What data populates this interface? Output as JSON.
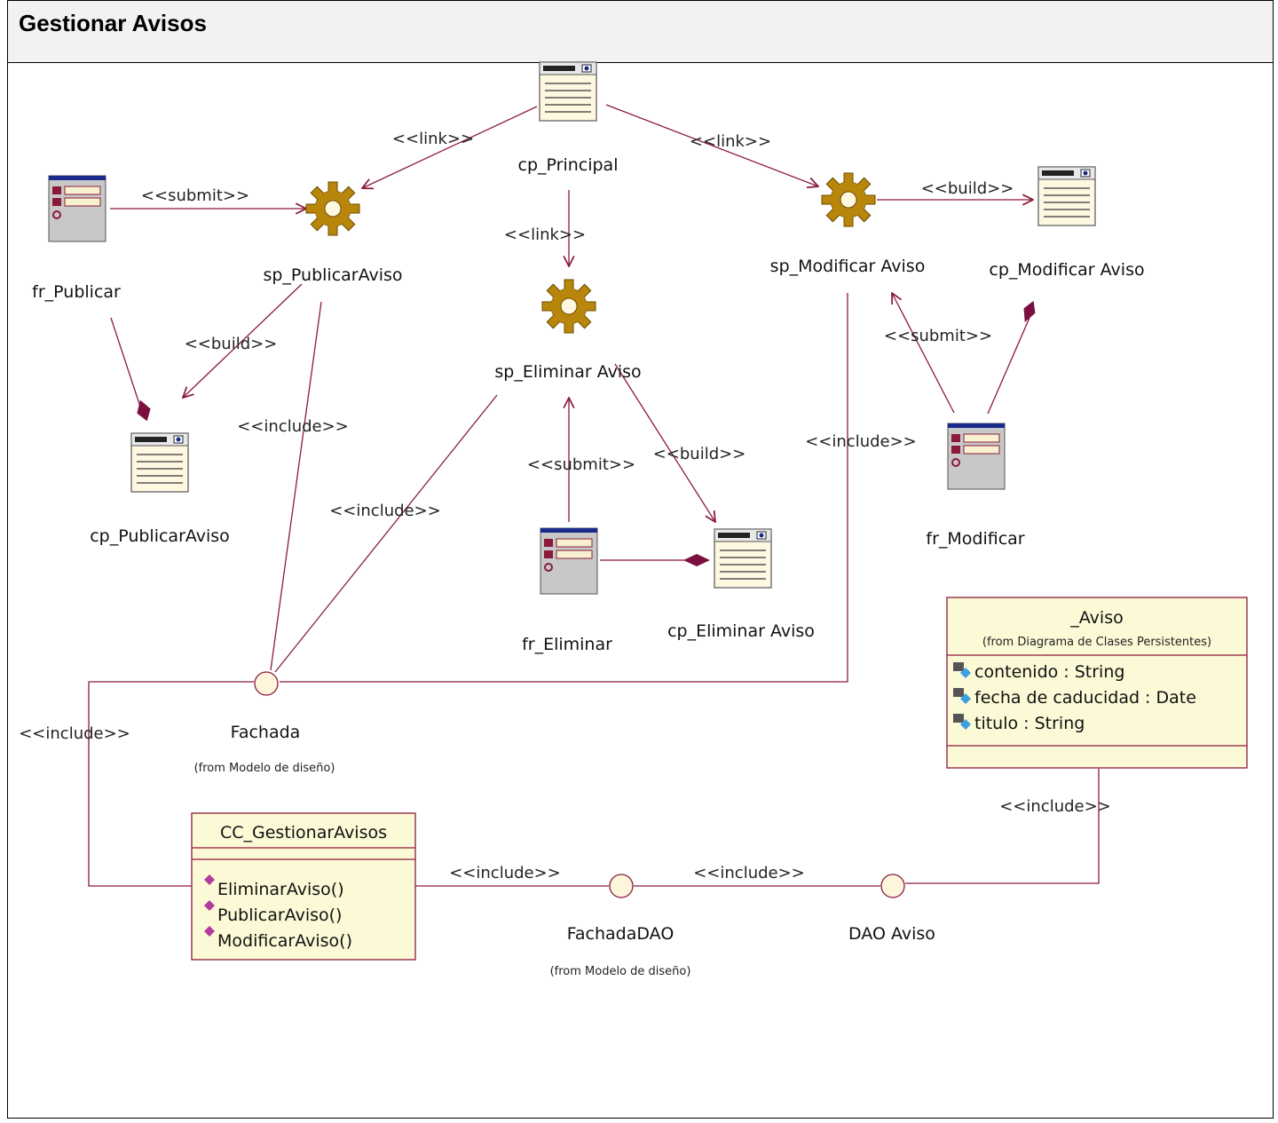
{
  "title": "Gestionar Avisos",
  "nodes": {
    "cp_principal": "cp_Principal",
    "sp_publicar": "sp_PublicarAviso",
    "sp_eliminar": "sp_Eliminar Aviso",
    "sp_modificar": "sp_Modificar Aviso",
    "cp_modificar": "cp_Modificar Aviso",
    "fr_publicar": "fr_Publicar",
    "cp_publicar": "cp_PublicarAviso",
    "fr_eliminar": "fr_Eliminar",
    "cp_eliminar": "cp_Eliminar Aviso",
    "fr_modificar": "fr_Modificar",
    "fachada": "Fachada",
    "fachada_from": "(from Modelo de diseño)",
    "fachada_dao": "FachadaDAO",
    "fachada_dao_from": "(from Modelo de diseño)",
    "dao_aviso": "DAO Aviso"
  },
  "stereotypes": {
    "link1": "<<link>>",
    "link2": "<<link>>",
    "link3": "<<link>>",
    "submit1": "<<submit>>",
    "submit2": "<<submit>>",
    "submit3": "<<submit>>",
    "build1": "<<build>>",
    "build2": "<<build>>",
    "build3": "<<build>>",
    "include1": "<<include>>",
    "include2": "<<include>>",
    "include3": "<<include>>",
    "include4": "<<include>>",
    "include5": "<<include>>",
    "include6": "<<include>>",
    "include7": "<<include>>"
  },
  "classes": {
    "cc": {
      "name": "CC_GestionarAvisos",
      "operations": [
        "EliminarAviso()",
        "PublicarAviso()",
        "ModificarAviso()"
      ]
    },
    "aviso": {
      "name": "_Aviso",
      "from": "(from Diagrama de Clases Persistentes)",
      "attributes": [
        "contenido : String",
        "fecha de caducidad : Date",
        "titulo : String"
      ]
    }
  },
  "colors": {
    "class_fill": "#fcf9d6",
    "gear": "#b8860b",
    "diamond": "#7a1040",
    "line": "#8b1a3a",
    "interface_fill": "#fdf6dc"
  }
}
